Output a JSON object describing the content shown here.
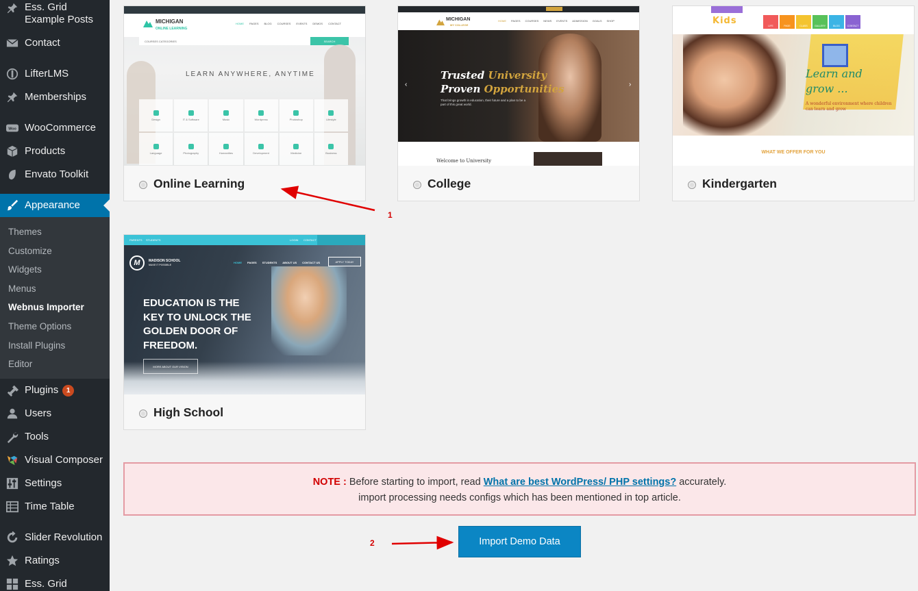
{
  "sidebar": {
    "menu": [
      {
        "id": "essgrid-posts",
        "label": "Ess. Grid Example Posts",
        "icon": "pin-icon"
      },
      {
        "id": "contact",
        "label": "Contact",
        "icon": "envelope-icon"
      },
      {
        "id": "lifterlms",
        "label": "LifterLMS",
        "icon": "lifter-icon"
      },
      {
        "id": "memberships",
        "label": "Memberships",
        "icon": "pin-icon"
      },
      {
        "id": "woocommerce",
        "label": "WooCommerce",
        "icon": "woo-icon"
      },
      {
        "id": "products",
        "label": "Products",
        "icon": "box-icon"
      },
      {
        "id": "envato",
        "label": "Envato Toolkit",
        "icon": "leaf-icon"
      },
      {
        "id": "appearance",
        "label": "Appearance",
        "icon": "brush-icon"
      },
      {
        "id": "plugins",
        "label": "Plugins",
        "icon": "plug-icon",
        "badge": "1"
      },
      {
        "id": "users",
        "label": "Users",
        "icon": "user-icon"
      },
      {
        "id": "tools",
        "label": "Tools",
        "icon": "wrench-icon"
      },
      {
        "id": "vc",
        "label": "Visual Composer",
        "icon": "vc-icon"
      },
      {
        "id": "settings",
        "label": "Settings",
        "icon": "sliders-icon"
      },
      {
        "id": "timetable",
        "label": "Time Table",
        "icon": "table-icon"
      },
      {
        "id": "slider",
        "label": "Slider Revolution",
        "icon": "refresh-icon"
      },
      {
        "id": "ratings",
        "label": "Ratings",
        "icon": "star-icon"
      },
      {
        "id": "essgrid",
        "label": "Ess. Grid",
        "icon": "grid-icon"
      }
    ],
    "submenu": [
      "Themes",
      "Customize",
      "Widgets",
      "Menus",
      "Webnus Importer",
      "Theme Options",
      "Install Plugins",
      "Editor"
    ],
    "current_submenu": "Webnus Importer"
  },
  "demos": [
    {
      "title": "Online Learning"
    },
    {
      "title": "College"
    },
    {
      "title": "Kindergarten"
    },
    {
      "title": "High School"
    }
  ],
  "thumbs": {
    "michigan": {
      "logo": "MICHIGAN",
      "tagline": "ONLINE LEARNING",
      "nav": [
        "HOME",
        "PAGES",
        "BLOG",
        "COURSES",
        "EVENTS",
        "DEMOS",
        "CONTACT"
      ],
      "categories": "COURSES CATEGORIES",
      "search_btn": "SEARCH",
      "hero": "LEARN ANYWHERE, ANYTIME",
      "tiles": [
        "Design",
        "IT & Software",
        "Music",
        "Wordpress",
        "Photoshop",
        "Lifestyle",
        "Language",
        "Photography",
        "Humanities",
        "Development",
        "Medicine",
        "Business"
      ]
    },
    "college": {
      "logo": "MICHIGAN",
      "tagline": "MY COLLEGE",
      "nav": [
        "HOME",
        "PAGES",
        "COURSES",
        "NEWS",
        "EVENTS",
        "ADMISSION",
        "GOALS",
        "SHOP"
      ],
      "line1a": "Trusted ",
      "line1b": "University",
      "line2a": "Proven ",
      "line2b": "Opportunities",
      "sub": "That brings growth in education, their future and a plan to be a part of this great world.",
      "welcome": "Welcome to University"
    },
    "kinder": {
      "logo": "Kids",
      "hero1": "Learn and",
      "hero2": "grow ...",
      "sub": "A wonderful environment where children can learn and grow",
      "offer": "WHAT WE OFFER FOR YOU",
      "nav": [
        "LIFE",
        "PAGE",
        "CLASS",
        "GALLERY",
        "BLOG",
        "CONTACT"
      ]
    },
    "madison": {
      "top": [
        "PARENTS",
        "STUDENTS"
      ],
      "top_right": [
        "LOGIN",
        "CONTACT"
      ],
      "logo": "MADISON SCHOOL",
      "logo_sub": "MAKE IT POSSIBLE",
      "nav": [
        "HOME",
        "PAGES",
        "STUDENTS",
        "ABOUT US",
        "CONTACT US"
      ],
      "apply": "APPLY TODAY",
      "hero": [
        "EDUCATION IS THE",
        "KEY TO UNLOCK THE",
        "GOLDEN DOOR OF",
        "FREEDOM."
      ],
      "cta": "MORE ABOUT OUR VISION"
    }
  },
  "note": {
    "label": "NOTE :",
    "text_before": " Before starting to import, read ",
    "link": "What are best WordPress/ PHP settings?",
    "text_after": " accurately.",
    "line2": "import processing needs configs which has been mentioned in top article."
  },
  "import_button": "Import Demo Data",
  "annotations": [
    "1",
    "2"
  ],
  "colors": {
    "sidebar_bg": "#23282d",
    "accent": "#0073aa",
    "note_bg": "#fbe7e9",
    "note_label": "#d10000",
    "annotation": "#d40000"
  }
}
